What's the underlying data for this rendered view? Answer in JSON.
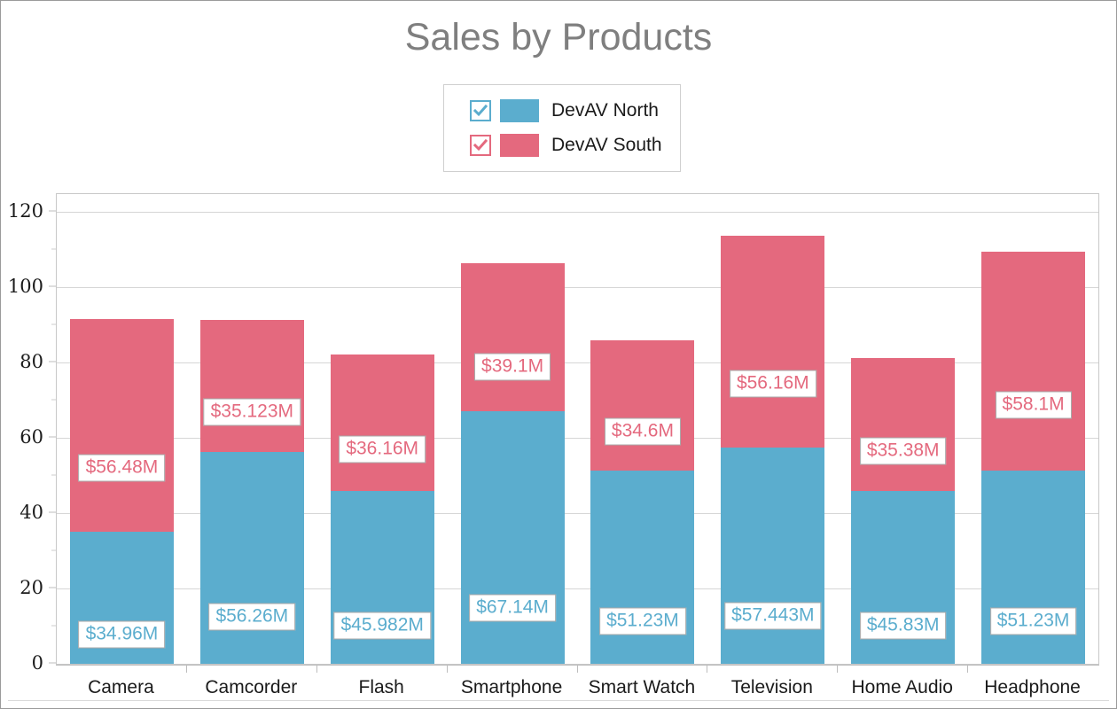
{
  "chart_data": {
    "type": "bar",
    "stacked": true,
    "title": "Sales by Products",
    "xlabel": "",
    "ylabel": "",
    "ylim": [
      0,
      120
    ],
    "y_ticks": [
      0,
      20,
      40,
      60,
      80,
      100,
      120
    ],
    "y_tick_labels": [
      "0",
      "20",
      "40",
      "60",
      "80",
      "100",
      "120"
    ],
    "y_minor_step": 10,
    "grid": true,
    "legend_position": "top-center",
    "categories": [
      "Camera",
      "Camcorder",
      "Flash",
      "Smartphone",
      "Smart Watch",
      "Television",
      "Home Audio",
      "Headphone"
    ],
    "series": [
      {
        "name": "DevAV North",
        "color": "#5badce",
        "values": [
          34.96,
          56.26,
          45.982,
          67.14,
          51.23,
          57.443,
          45.83,
          51.23
        ],
        "labels": [
          "$34.96M",
          "$56.26M",
          "$45.982M",
          "$67.14M",
          "$51.23M",
          "$57.443M",
          "$45.83M",
          "$51.23M"
        ]
      },
      {
        "name": "DevAV South",
        "color": "#e4697e",
        "values": [
          56.48,
          35.123,
          36.16,
          39.1,
          34.6,
          56.16,
          35.38,
          58.1
        ],
        "labels": [
          "$56.48M",
          "$35.123M",
          "$36.16M",
          "$39.1M",
          "$34.6M",
          "$56.16M",
          "$35.38M",
          "$58.1M"
        ]
      }
    ],
    "totals": [
      91.44,
      91.383,
      82.142,
      106.24,
      85.83,
      113.603,
      81.21,
      109.33
    ]
  },
  "legend": {
    "items": [
      {
        "label": "DevAV North",
        "color": "#5badce",
        "checked": true,
        "checkbox_icon": "checkmark-icon"
      },
      {
        "label": "DevAV South",
        "color": "#e4697e",
        "checked": true,
        "checkbox_icon": "checkmark-icon"
      }
    ]
  },
  "colors": {
    "title": "#7f7f7f",
    "north": "#5badce",
    "south": "#e4697e",
    "grid": "#d6d6d6",
    "frame": "#c8c8c8",
    "label_border": "#a8a8a8",
    "page_border": "#9a9a9a"
  }
}
